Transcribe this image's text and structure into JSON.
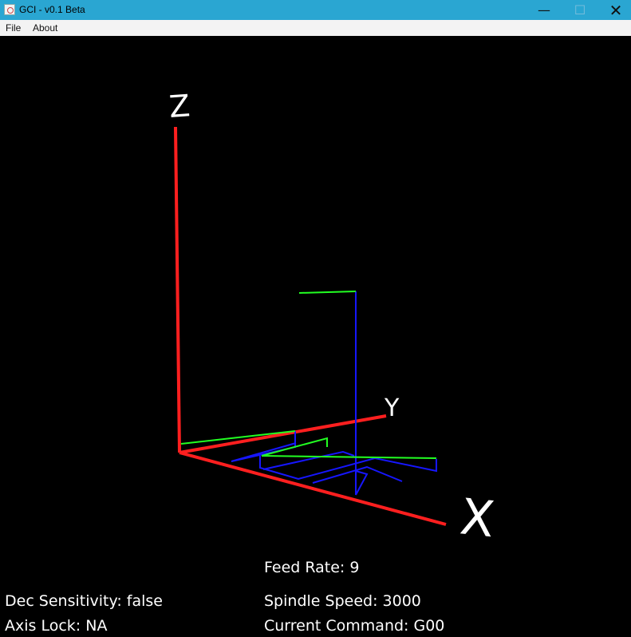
{
  "window": {
    "title": "GCI - v0.1 Beta",
    "controls": {
      "minimize": "—",
      "maximize": "☐",
      "close": "✕"
    }
  },
  "menu": {
    "items": [
      "File",
      "About"
    ]
  },
  "axes": {
    "x_label": "X",
    "y_label": "Y",
    "z_label": "Z"
  },
  "status": {
    "feed_rate": "Feed Rate: 9",
    "spindle_speed": "Spindle Speed: 3000",
    "current_command": "Current Command: G00",
    "dec_sensitivity": "Dec Sensitivity: false",
    "axis_lock": "Axis Lock: NA"
  },
  "colors": {
    "background": "#000000",
    "titlebar": "#2aa6d2",
    "axis": "#ff1f1f",
    "rapid_path": "#22ff22",
    "cut_path": "#1616ff",
    "text": "#ffffff"
  }
}
